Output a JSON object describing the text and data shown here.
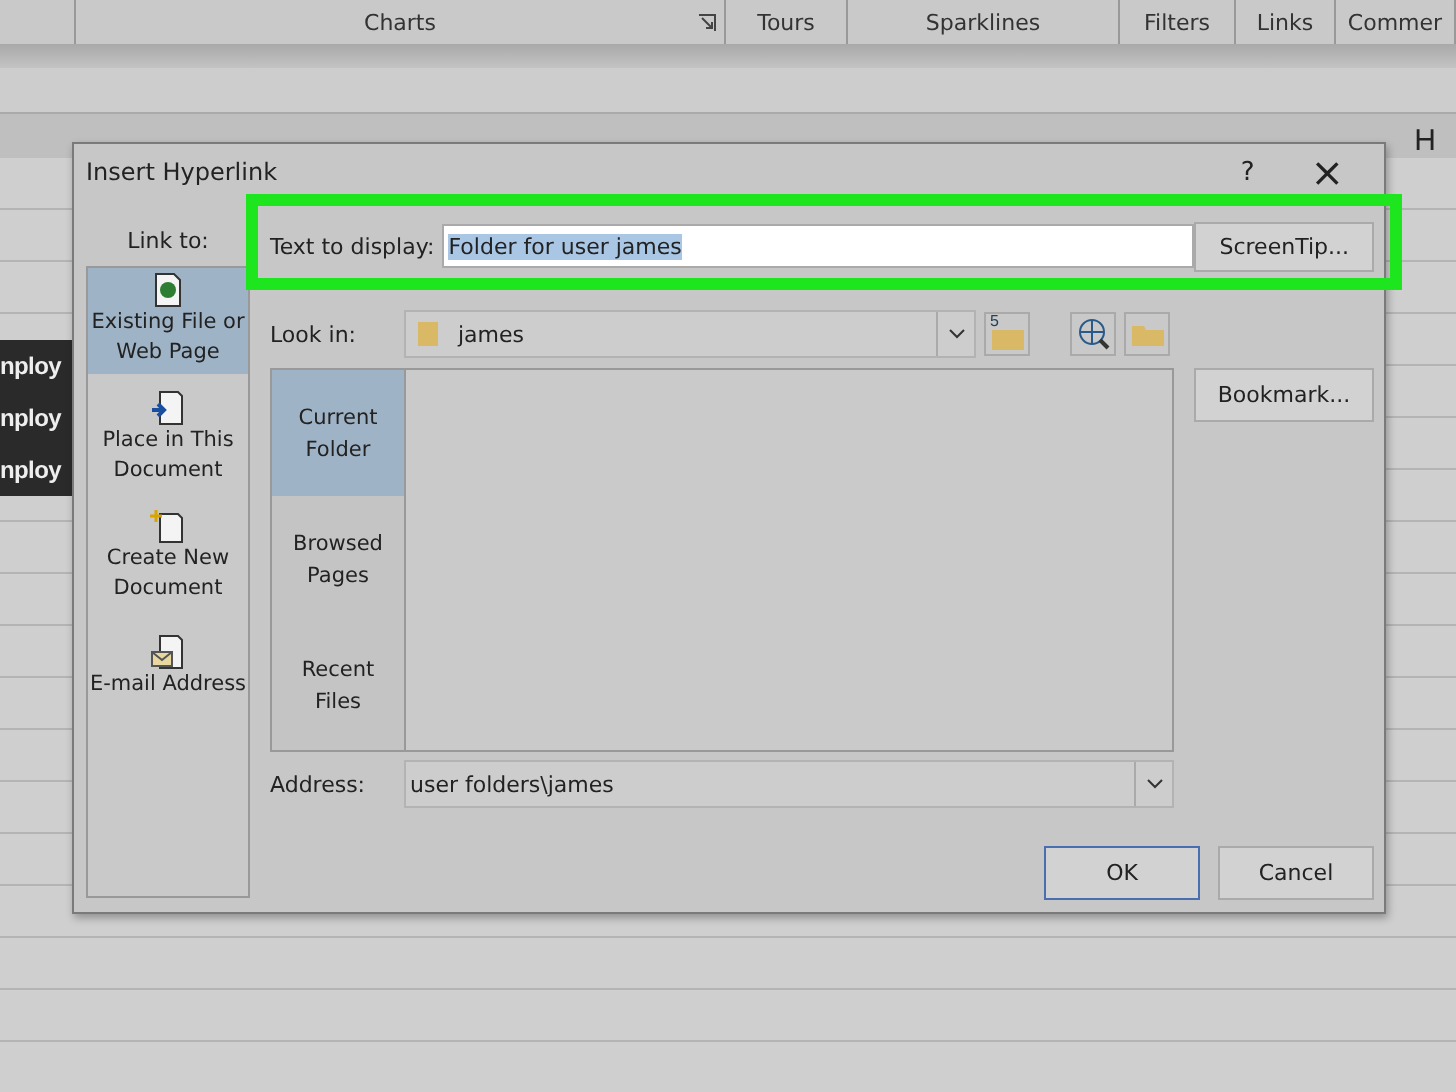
{
  "ribbon": {
    "groups": [
      {
        "label": "Charts",
        "launcher": true
      },
      {
        "label": "Tours",
        "launcher": false
      },
      {
        "label": "Sparklines",
        "launcher": false
      },
      {
        "label": "Filters",
        "launcher": false
      },
      {
        "label": "Links",
        "launcher": false
      },
      {
        "label": "Commer",
        "launcher": false
      }
    ]
  },
  "sheet": {
    "column_header": "H",
    "cells": [
      "nploy",
      "nploy",
      "nploy"
    ]
  },
  "dialog": {
    "title": "Insert Hyperlink",
    "help": "?",
    "close": "×",
    "link_to_label": "Link to:",
    "link_to": [
      {
        "label": "Existing File or Web Page",
        "kind": "file",
        "selected": true
      },
      {
        "label": "Place in This Document",
        "kind": "place",
        "selected": false
      },
      {
        "label": "Create New Document",
        "kind": "new",
        "selected": false
      },
      {
        "label": "E-mail Address",
        "kind": "mail",
        "selected": false
      }
    ],
    "text_to_display": {
      "label": "Text to display:",
      "value": "Folder for user james",
      "selected": true
    },
    "screentip_button": "ScreenTip...",
    "look_in": {
      "label": "Look in:",
      "value": "james",
      "up_button_number": "5"
    },
    "browse_tabs": [
      {
        "label": "Current Folder",
        "selected": true
      },
      {
        "label": "Browsed Pages",
        "selected": false
      },
      {
        "label": "Recent Files",
        "selected": false
      }
    ],
    "bookmark_button": "Bookmark...",
    "address": {
      "label": "Address:",
      "value": "user folders\\james"
    },
    "buttons": [
      {
        "label": "OK",
        "default": true
      },
      {
        "label": "Cancel",
        "default": false
      }
    ]
  }
}
